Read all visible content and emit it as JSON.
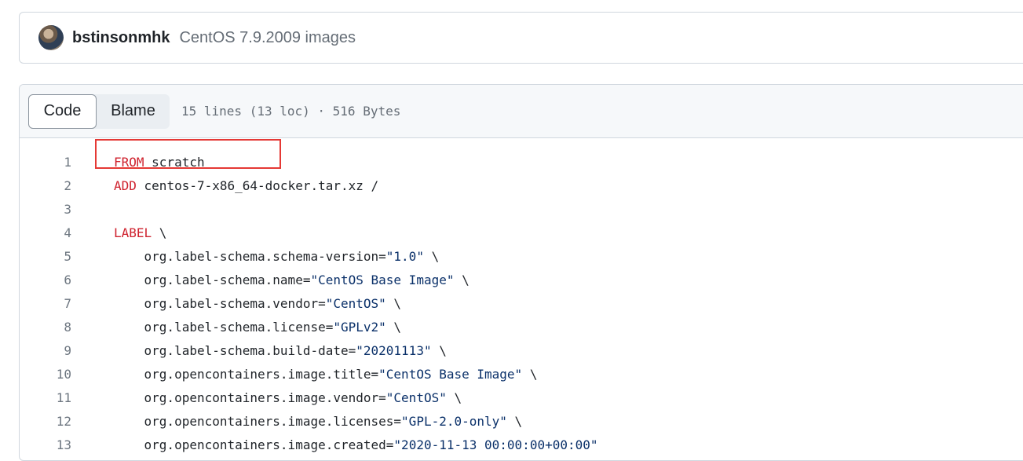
{
  "commit": {
    "author": "bstinsonmhk",
    "message": "CentOS 7.9.2009 images"
  },
  "file_header": {
    "code_label": "Code",
    "blame_label": "Blame",
    "info": "15 lines (13 loc) · 516 Bytes"
  },
  "code_lines": [
    {
      "n": "1",
      "kw": "FROM",
      "rest": " scratch",
      "str": "",
      "tail": ""
    },
    {
      "n": "2",
      "kw": "ADD",
      "rest": " centos-7-x86_64-docker.tar.xz /",
      "str": "",
      "tail": ""
    },
    {
      "n": "3",
      "kw": "",
      "rest": "",
      "str": "",
      "tail": ""
    },
    {
      "n": "4",
      "kw": "LABEL",
      "rest": " \\",
      "str": "",
      "tail": ""
    },
    {
      "n": "5",
      "kw": "",
      "rest": "    org.label-schema.schema-version=",
      "str": "\"1.0\"",
      "tail": " \\"
    },
    {
      "n": "6",
      "kw": "",
      "rest": "    org.label-schema.name=",
      "str": "\"CentOS Base Image\"",
      "tail": " \\"
    },
    {
      "n": "7",
      "kw": "",
      "rest": "    org.label-schema.vendor=",
      "str": "\"CentOS\"",
      "tail": " \\"
    },
    {
      "n": "8",
      "kw": "",
      "rest": "    org.label-schema.license=",
      "str": "\"GPLv2\"",
      "tail": " \\"
    },
    {
      "n": "9",
      "kw": "",
      "rest": "    org.label-schema.build-date=",
      "str": "\"20201113\"",
      "tail": " \\"
    },
    {
      "n": "10",
      "kw": "",
      "rest": "    org.opencontainers.image.title=",
      "str": "\"CentOS Base Image\"",
      "tail": " \\"
    },
    {
      "n": "11",
      "kw": "",
      "rest": "    org.opencontainers.image.vendor=",
      "str": "\"CentOS\"",
      "tail": " \\"
    },
    {
      "n": "12",
      "kw": "",
      "rest": "    org.opencontainers.image.licenses=",
      "str": "\"GPL-2.0-only\"",
      "tail": " \\"
    },
    {
      "n": "13",
      "kw": "",
      "rest": "    org.opencontainers.image.created=",
      "str": "\"2020-11-13 00:00:00+00:00\"",
      "tail": ""
    }
  ]
}
